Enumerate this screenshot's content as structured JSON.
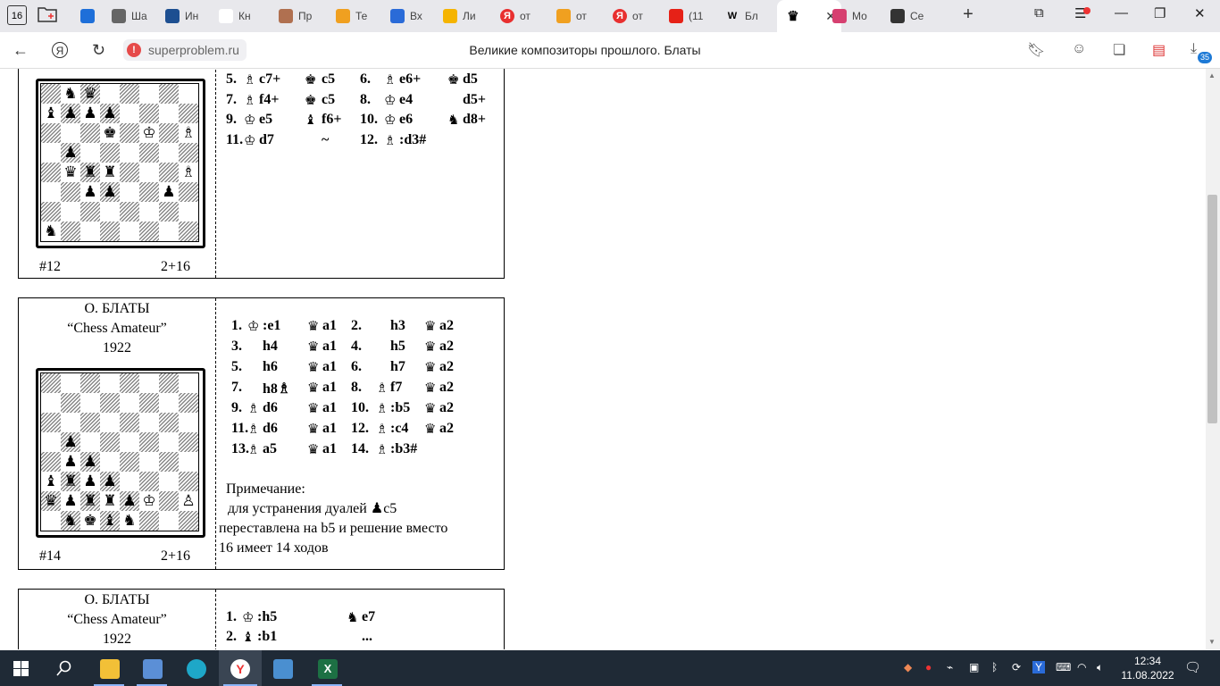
{
  "browser": {
    "tab_count": "16",
    "tabs": [
      {
        "label": "",
        "icon": "mail-icon",
        "color": "#1e6fd9"
      },
      {
        "label": "Ша",
        "icon": "document-icon",
        "color": "#666666"
      },
      {
        "label": "Ин",
        "icon": "shield-icon",
        "color": "#1d4f91"
      },
      {
        "label": "Кн",
        "icon": "blank-icon",
        "color": "#ffffff"
      },
      {
        "label": "Пр",
        "icon": "avatar-icon",
        "color": "#b07050"
      },
      {
        "label": "Те",
        "icon": "globe-icon",
        "color": "#f0a020"
      },
      {
        "label": "Вх",
        "icon": "y-mail-icon",
        "color": "#2a6bd8"
      },
      {
        "label": "Ли",
        "icon": "colorful-icon",
        "color": "#f5b400"
      },
      {
        "label": "от",
        "icon": "yandex-icon",
        "color": "#e82f2f"
      },
      {
        "label": "от",
        "icon": "image-icon",
        "color": "#f0a020"
      },
      {
        "label": "от",
        "icon": "yandex-icon",
        "color": "#e82f2f"
      },
      {
        "label": "(11",
        "icon": "youtube-icon",
        "color": "#e62117"
      },
      {
        "label": "Бл",
        "icon": "wikipedia-icon",
        "color": "#333333"
      },
      {
        "label": "",
        "icon": "chess-queen-icon",
        "color": "#000000"
      },
      {
        "label": "Мо",
        "icon": "flower-icon",
        "color": "#d64070"
      },
      {
        "label": "Се",
        "icon": "spiral-icon",
        "color": "#333333"
      }
    ],
    "url": "superproblem.ru",
    "page_title": "Великие композиторы прошлого. Блаты"
  },
  "problems": [
    {
      "header": [],
      "footer_left": "#12",
      "footer_right": "2+16",
      "board": [
        "........",
        ".♞♛.....",
        "♝♟♟♟....",
        "...♚.♔.♗",
        ".♟......",
        ".♛♜♜...♗",
        "..♟♟..♟.",
        "........",
        "♞......."
      ],
      "solution": [
        [
          "5. ",
          "♗",
          "c7+",
          "♚",
          "c5",
          "6. ",
          "♗",
          "e6+",
          "♚",
          "d5"
        ],
        [
          "7. ",
          "♗",
          "f4+",
          "♚",
          "c5",
          "8. ",
          "♔",
          "e4",
          "",
          "d5+"
        ],
        [
          "9. ",
          "♔",
          "e5",
          "♝",
          "f6+",
          "10. ",
          "♔",
          "e6",
          "♞",
          "d8+"
        ],
        [
          "11. ",
          "♔",
          "d7",
          "",
          "~",
          "12. ",
          "♗",
          ":d3#",
          "",
          ""
        ]
      ],
      "note": []
    },
    {
      "header": [
        "О. БЛАТЫ",
        "“Chess Amateur”",
        "1922"
      ],
      "footer_left": "#14",
      "footer_right": "2+16",
      "board": [
        "........",
        "........",
        "........",
        ".♟......",
        ".♟♟.....",
        "♝♜♟♟....",
        "♛♟♜♜♟♔.♙",
        ".♞♚♝♞..."
      ],
      "solution": [
        [
          "1. ",
          "♔",
          ":e1",
          "♛",
          "a1",
          "2. ",
          "",
          "h3",
          "♛",
          "a2"
        ],
        [
          "3. ",
          "",
          "h4",
          "♛",
          "a1",
          "4. ",
          "",
          "h5",
          "♛",
          "a2"
        ],
        [
          "5. ",
          "",
          "h6",
          "♛",
          "a1",
          "6. ",
          "",
          "h7",
          "♛",
          "a2"
        ],
        [
          "7. ",
          "",
          "h8♗",
          "♛",
          "a1",
          "8. ",
          "♗",
          "f7",
          "♛",
          "a2"
        ],
        [
          "9. ",
          "♗",
          "d6",
          "♛",
          "a1",
          "10. ",
          "♗",
          ":b5",
          "♛",
          "a2"
        ],
        [
          "11. ",
          "♗",
          "d6",
          "♛",
          "a1",
          "12. ",
          "♗",
          ":c4",
          "♛",
          "a2"
        ],
        [
          "13. ",
          "♗",
          "a5",
          "♛",
          "a1",
          "14. ",
          "♗",
          ":b3#",
          "",
          ""
        ]
      ],
      "note": [
        "Примечание:",
        "для устранения дуалей ♟c5",
        "переставлена на b5 и решение вместо",
        "16 имеет 14 ходов"
      ]
    },
    {
      "header": [
        "О. БЛАТЫ",
        "“Chess Amateur”",
        "1922"
      ],
      "solution": [
        [
          "1. ",
          "♔",
          ":h5",
          "♞",
          "e7"
        ],
        [
          "2. ",
          "♝",
          ":b1",
          "",
          "..."
        ]
      ]
    }
  ],
  "taskbar": {
    "time": "12:34",
    "date": "11.08.2022",
    "icons": [
      "windows-start-icon",
      "search-icon",
      "file-explorer-icon",
      "network-admin-icon",
      "edge-icon",
      "yandex-browser-icon",
      "chess-app-icon",
      "excel-icon"
    ]
  }
}
